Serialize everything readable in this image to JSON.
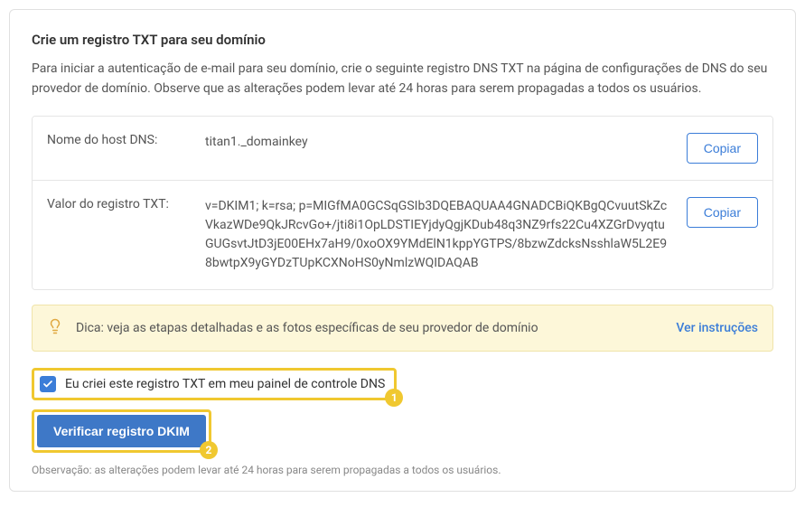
{
  "title": "Crie um registro TXT para seu domínio",
  "description": "Para iniciar a autenticação de e-mail para seu domínio, crie o seguinte registro DNS TXT na página de configurações de DNS do seu provedor de domínio. Observe que as alterações podem levar até 24 horas para serem propagadas a todos os usuários.",
  "records": {
    "host_label": "Nome do host DNS:",
    "host_value": "titan1._domainkey",
    "txt_label": "Valor do registro TXT:",
    "txt_value": "v=DKIM1; k=rsa; p=MIGfMA0GCSqGSIb3DQEBAQUAA4GNADCBiQKBgQCvuutSkZcVkazWDe9QkJRcvGo+/jti8i1OpLDSTIEYjdyQgjKDub48q3NZ9rfs22Cu4XZGrDvyqtuGUGsvtJtD3jE00EHx7aH9/0xoOX9YMdElN1kppYGTPS/8bzwZdcksNsshlaW5L2E98bwtpX9yGYDzTUpKCXNoHS0yNmlzWQIDAQAB",
    "copy_label": "Copiar"
  },
  "hint": {
    "text": "Dica: veja as etapas detalhadas e as fotos específicas de seu provedor de domínio",
    "link": "Ver instruções"
  },
  "checkbox": {
    "label": "Eu criei este registro TXT em meu painel de controle DNS",
    "badge": "1"
  },
  "verify": {
    "label": "Verificar registro DKIM",
    "badge": "2"
  },
  "note": "Observação: as alterações podem levar até 24 horas para serem propagadas a todos os usuários."
}
